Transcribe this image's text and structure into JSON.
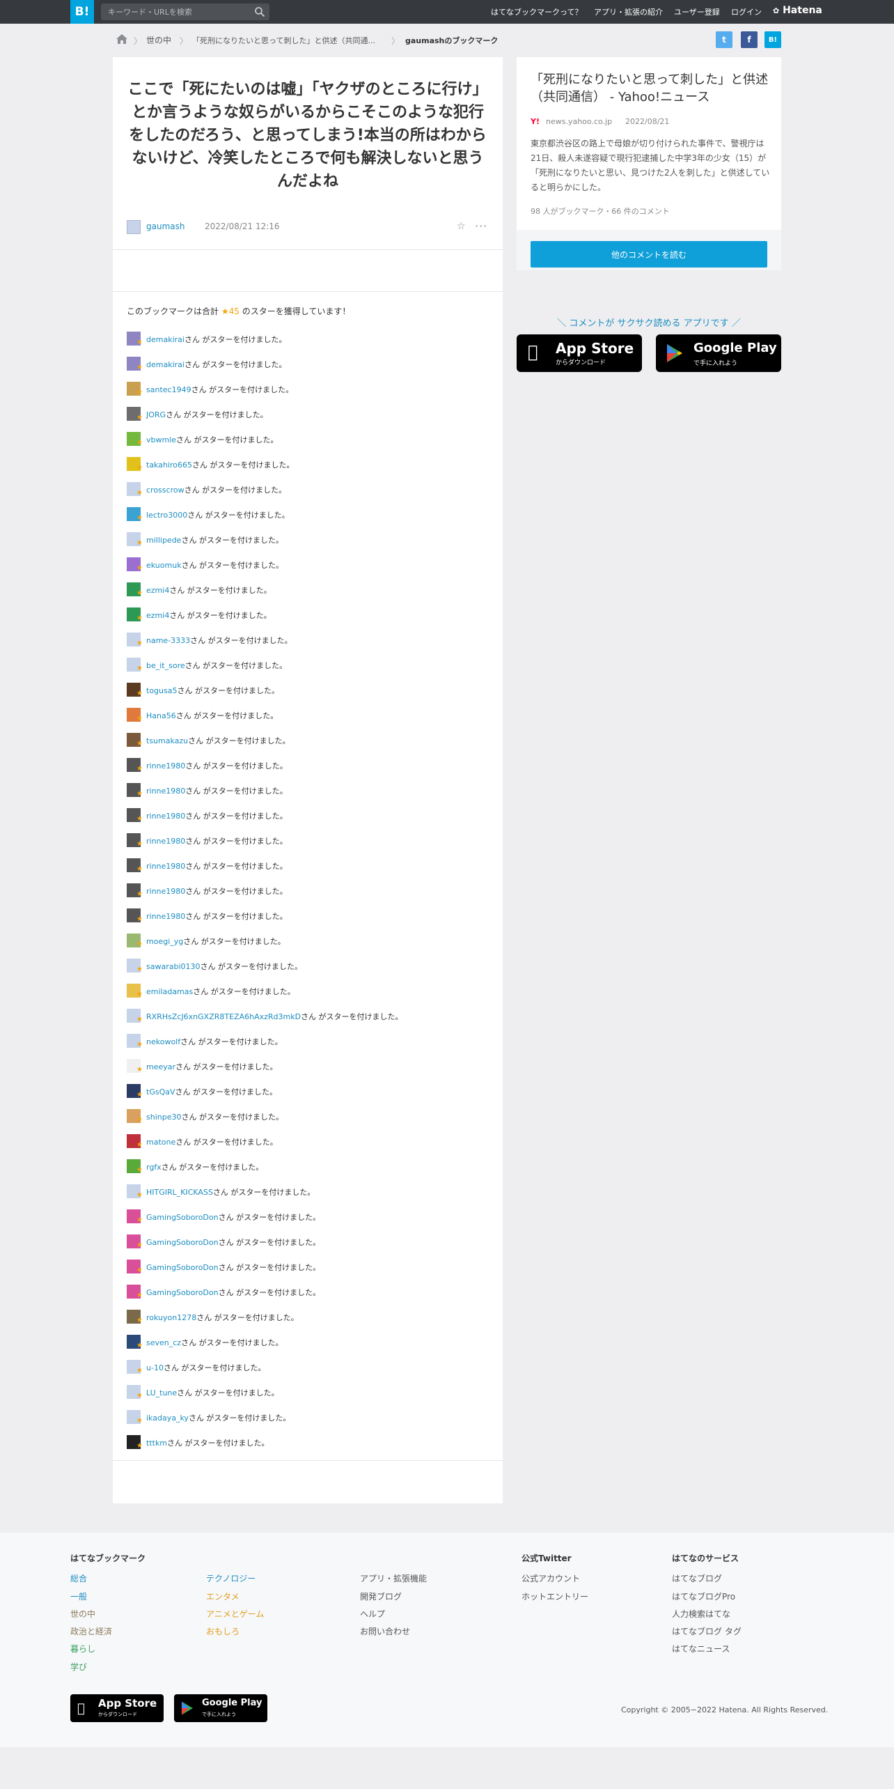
{
  "topbar": {
    "logo": "B!",
    "search_placeholder": "キーワード・URLを検索",
    "nav": [
      "はてなブックマークって？",
      "アプリ・拡張の紹介",
      "ユーザー登録",
      "ログイン"
    ],
    "brand": "Hatena"
  },
  "breadcrumb": {
    "items": [
      "世の中",
      "「死刑になりたいと思って刺した」と供述（共同通...",
      "gaumashのブックマーク"
    ]
  },
  "social": {
    "twitter": "t",
    "facebook": "f",
    "hatena": "B!"
  },
  "bookmark": {
    "comment": "ここで「死にたいのは嘘」「ヤクザのところに行け」とか言うような奴らがいるからこそこのような犯行をしたのだろう、と思ってしまう!本当の所はわからないけど、冷笑したところで何も解決しないと思うんだよね",
    "user": "gaumash",
    "date": "2022/08/21 12:16"
  },
  "stars": {
    "summary_prefix": "このブックマークは合計",
    "count": "★45",
    "summary_suffix": "のスターを獲得しています！",
    "suffix": "さん がスターを付けました。",
    "users": [
      "demakirai",
      "demakirai",
      "santec1949",
      "JORG",
      "vbwmle",
      "takahiro665",
      "crosscrow",
      "lectro3000",
      "millipede",
      "ekuomuk",
      "ezmi4",
      "ezmi4",
      "name-3333",
      "be_it_sore",
      "togusa5",
      "Hana56",
      "tsumakazu",
      "rinne1980",
      "rinne1980",
      "rinne1980",
      "rinne1980",
      "rinne1980",
      "rinne1980",
      "rinne1980",
      "moegi_yg",
      "sawarabi0130",
      "emiladamas",
      "RXRHsZcJ6xnGXZR8TEZA6hAxzRd3mkD",
      "nekowolf",
      "meeyar",
      "tGsQaV",
      "shinpe30",
      "matone",
      "rgfx",
      "HITGIRL_KICKASS",
      "GamingSoboroDon",
      "GamingSoboroDon",
      "GamingSoboroDon",
      "GamingSoboroDon",
      "rokuyon1278",
      "seven_cz",
      "u-10",
      "LU_tune",
      "ikadaya_ky",
      "tttkm"
    ],
    "avatar_colors": [
      "#8e85c2",
      "#8e85c2",
      "#c9a04e",
      "#6d6d6d",
      "#74b83e",
      "#e2c21a",
      "#c6d3e8",
      "#3aa3d4",
      "#c6d3e8",
      "#9b6fd1",
      "#2c9a54",
      "#2c9a54",
      "#c6d3e8",
      "#c6d3e8",
      "#5a3b22",
      "#e07a3c",
      "#7a5a3a",
      "#555555",
      "#555555",
      "#555555",
      "#555555",
      "#555555",
      "#555555",
      "#555555",
      "#9bb870",
      "#c6d3e8",
      "#e8c04a",
      "#c6d3e8",
      "#c6d3e8",
      "#f0f0f0",
      "#2a3b66",
      "#d9a060",
      "#c0303a",
      "#5aaa3a",
      "#c6d3e8",
      "#d94f9a",
      "#d94f9a",
      "#d94f9a",
      "#d94f9a",
      "#7a6a4a",
      "#2a4a7a",
      "#c6d3e8",
      "#c6d3e8",
      "#c6d3e8",
      "#222222"
    ]
  },
  "side": {
    "title": "「死刑になりたいと思って刺した」と供述（共同通信） - Yahoo!ニュース",
    "y_icon": "Y!",
    "domain": "news.yahoo.co.jp",
    "date": "2022/08/21",
    "description": "東京都渋谷区の路上で母娘が切り付けられた事件で、警視庁は21日、殺人未遂容疑で現行犯逮捕した中学3年の少女（15）が「死刑になりたいと思い、見つけた2人を刺した」と供述していると明らかにした。",
    "meta": "98 人がブックマーク・66 件のコメント",
    "read_button": "他のコメントを読む"
  },
  "app_promo": {
    "text": "＼ コメントが サクサク読める アプリです ／",
    "appstore_small": "からダウンロード",
    "appstore_big": "App Store",
    "googleplay_small": "で手に入れよう",
    "googleplay_big": "Google Play"
  },
  "footer": {
    "col1_head": "はてなブックマーク",
    "col1": [
      "総合",
      "一般",
      "世の中",
      "政治と経済",
      "暮らし",
      "学び"
    ],
    "col2": [
      "テクノロジー",
      "エンタメ",
      "アニメとゲーム",
      "おもしろ"
    ],
    "col3": [
      "アプリ・拡張機能",
      "開発ブログ",
      "ヘルプ",
      "お問い合わせ"
    ],
    "col4_head": "公式Twitter",
    "col4": [
      "公式アカウント",
      "ホットエントリー"
    ],
    "col5_head": "はてなのサービス",
    "col5": [
      "はてなブログ",
      "はてなブログPro",
      "人力検索はてな",
      "はてなブログ タグ",
      "はてなニュース"
    ],
    "copyright": "Copyright © 2005−2022 Hatena. All Rights Reserved.",
    "link_colors": {
      "general": "#1c8dc0",
      "social": "#8a7a5a",
      "politics": "#8a7a5a",
      "life": "#3aa060",
      "learn": "#3aa060",
      "tech": "#1c8dc0",
      "ent": "#e0a020"
    }
  }
}
